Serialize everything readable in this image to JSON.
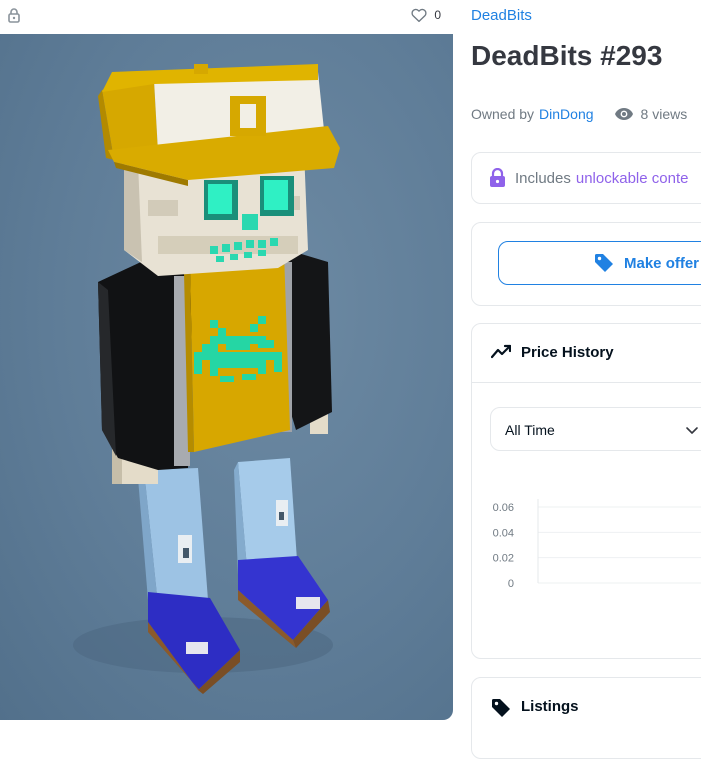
{
  "media": {
    "lock_icon": "lock-icon",
    "like_icon": "heart-icon",
    "like_count": "0",
    "background_color": "#5f7d98"
  },
  "collection": {
    "name": "DeadBits"
  },
  "item": {
    "title": "DeadBits #293",
    "owned_by_label": "Owned by",
    "owner": "DinDong",
    "views": "8 views"
  },
  "unlockable": {
    "prefix": "Includes",
    "link": "unlockable conte",
    "icon": "lock-icon",
    "color": "#8f62ea"
  },
  "offer": {
    "label": "Make offer",
    "icon": "tag-icon",
    "color": "#2081e2"
  },
  "price_history": {
    "title": "Price History",
    "icon": "trend-icon",
    "range_selected": "All Time"
  },
  "chart_data": {
    "type": "line",
    "title": "",
    "xlabel": "",
    "ylabel": "",
    "y_ticks": [
      "0.06",
      "0.04",
      "0.02",
      "0"
    ],
    "ylim": [
      0,
      0.06
    ],
    "grid": true,
    "series": []
  },
  "listings": {
    "title": "Listings",
    "icon": "tag-icon"
  }
}
